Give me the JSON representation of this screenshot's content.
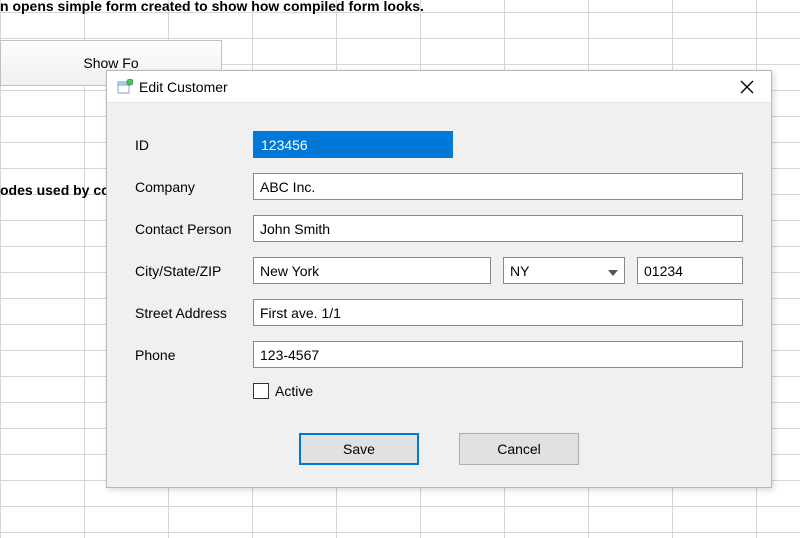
{
  "background": {
    "top_text": "n opens simple form created to show how compiled form looks.",
    "show_form_button": "Show Fo",
    "mid_text": "odes used by co"
  },
  "dialog": {
    "title": "Edit Customer",
    "labels": {
      "id": "ID",
      "company": "Company",
      "contact": "Contact Person",
      "csz": "City/State/ZIP",
      "street": "Street Address",
      "phone": "Phone",
      "active": "Active"
    },
    "values": {
      "id": "123456",
      "company": "ABC Inc.",
      "contact": "John Smith",
      "city": "New York",
      "state": "NY",
      "zip": "01234",
      "street": "First ave. 1/1",
      "phone": "123-4567",
      "active_checked": false
    },
    "buttons": {
      "save": "Save",
      "cancel": "Cancel"
    }
  }
}
